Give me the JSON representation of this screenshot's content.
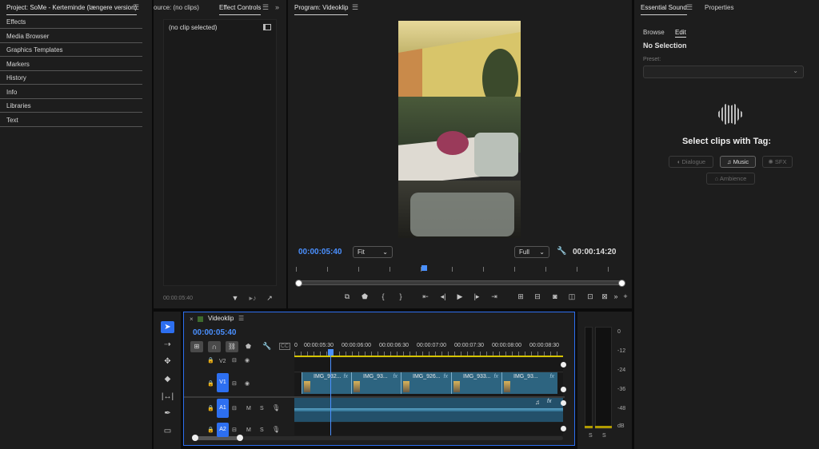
{
  "project": {
    "title": "Project: SoMe - Kerteminde (længere version)",
    "items": [
      "Effects",
      "Media Browser",
      "Graphics Templates",
      "Markers",
      "History",
      "Info",
      "Libraries",
      "Text"
    ]
  },
  "source": {
    "tab": "ource: (no clips)"
  },
  "effect_controls": {
    "tab": "Effect Controls",
    "no_clip": "(no clip selected)",
    "timecode": "00:00:05:40"
  },
  "program": {
    "title": "Program: Videoklip",
    "timecode": "00:00:05:40",
    "fit": "Fit",
    "quality": "Full",
    "duration": "00:00:14:20"
  },
  "essential_sound": {
    "tab": "Essential Sound",
    "properties_tab": "Properties",
    "browse": "Browse",
    "edit": "Edit",
    "no_selection": "No Selection",
    "preset_label": "Preset:",
    "select_clips": "Select clips with Tag:",
    "tags": [
      "Dialogue",
      "Music",
      "SFX",
      "Ambience"
    ]
  },
  "timeline": {
    "sequence": "Videoklip",
    "timecode": "00:00:05:40",
    "ruler": [
      "0",
      "00:00:05:30",
      "00:00:06:00",
      "00:00:06:30",
      "00:00:07:00",
      "00:00:07:30",
      "00:00:08:00",
      "00:00:08:30"
    ],
    "tracks": {
      "v2": "V2",
      "v1": "V1",
      "a1": "A1",
      "a2": "A2"
    },
    "mute": "M",
    "solo": "S",
    "clips": [
      "IMG_932...",
      "IMG_93...",
      "IMG_926...",
      "IMG_933...",
      "IMG_93..."
    ],
    "fx": "fx"
  },
  "audio_meter": {
    "scale": [
      "0",
      "-12",
      "-24",
      "-36",
      "-48",
      "dB"
    ],
    "solo": [
      "S",
      "S"
    ]
  },
  "icons": [
    "menu-icon",
    "funnel-icon",
    "play-icon",
    "step-back-icon",
    "step-forward-icon",
    "marker-icon",
    "wrench-icon",
    "camera-icon",
    "selection-tool-icon",
    "razor-icon",
    "pen-icon",
    "lock-icon",
    "eye-icon",
    "mic-icon",
    "waveform-icon",
    "music-note-icon"
  ],
  "colors": {
    "accent": "#2d6ff0",
    "timecode": "#4a90ff",
    "clip": "#2d6480",
    "audio": "#23506a",
    "playhead": "#4a90ff"
  }
}
